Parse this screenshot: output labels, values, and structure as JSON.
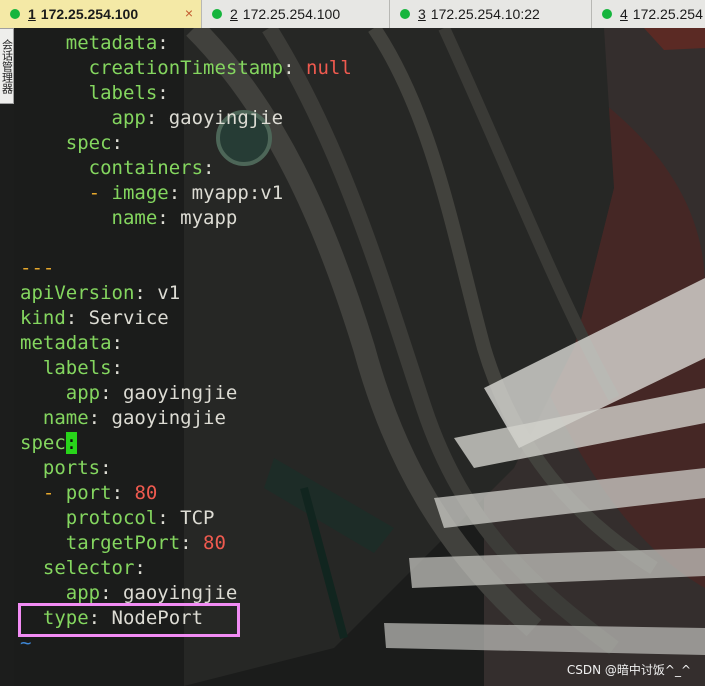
{
  "tabs": [
    {
      "number": "1",
      "host": "172.25.254.100",
      "active": true,
      "close": "×"
    },
    {
      "number": "2",
      "host": "172.25.254.100",
      "active": false
    },
    {
      "number": "3",
      "host": "172.25.254.10:22",
      "active": false
    },
    {
      "number": "4",
      "host": "172.25.254",
      "active": false
    }
  ],
  "sidebar": {
    "label": "会话管理器"
  },
  "code": {
    "metadata": "metadata",
    "creationTimestamp": "creationTimestamp",
    "null": "null",
    "labels": "labels",
    "app": "app",
    "gaoyingjie": "gaoyingjie",
    "spec": "spec",
    "containers": "containers",
    "image": "image",
    "image_value": "myapp:v1",
    "name": "name",
    "myapp": "myapp",
    "separator": "---",
    "apiVersion": "apiVersion",
    "v1": "v1",
    "kind": "kind",
    "service": "Service",
    "ports": "ports",
    "port": "port",
    "port_value": "80",
    "protocol": "protocol",
    "tcp": "TCP",
    "targetPort": "targetPort",
    "target_value": "80",
    "selector": "selector",
    "type": "type",
    "nodeport": "NodePort",
    "tilde": "~"
  },
  "colors": {
    "key": "#84d65f",
    "number": "#ef5a4f",
    "highlight": "#f28cf4",
    "cursor": "#28d41a"
  },
  "watermark": "CSDN @暗中讨饭^_^"
}
